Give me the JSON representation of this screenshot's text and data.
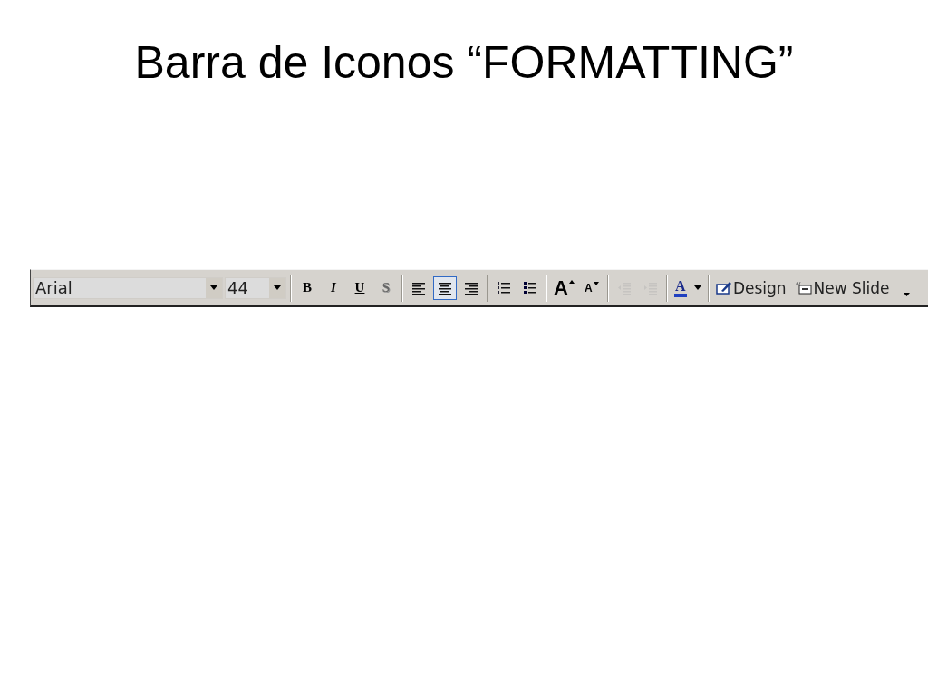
{
  "slide": {
    "title": "Barra de Iconos “FORMATTING”"
  },
  "toolbar": {
    "font": {
      "value": "Arial"
    },
    "size": {
      "value": "44"
    },
    "groups": [
      [
        {
          "kind": "bold",
          "label": "B",
          "disabled": false
        },
        {
          "kind": "italic",
          "label": "I",
          "disabled": false
        },
        {
          "kind": "underline",
          "label": "U",
          "disabled": false
        },
        {
          "kind": "shadow",
          "label": "S",
          "disabled": false
        }
      ],
      [
        {
          "kind": "align-left",
          "selected": false,
          "disabled": false
        },
        {
          "kind": "align-center",
          "selected": true,
          "disabled": false
        },
        {
          "kind": "align-right",
          "selected": false,
          "disabled": false
        }
      ],
      [
        {
          "kind": "numbering",
          "disabled": false
        },
        {
          "kind": "bullets",
          "disabled": false
        }
      ],
      [
        {
          "kind": "grow-font",
          "label": "A",
          "disabled": false
        },
        {
          "kind": "shrink-font",
          "label": "A",
          "disabled": false
        }
      ],
      [
        {
          "kind": "outdent",
          "disabled": true
        },
        {
          "kind": "indent",
          "disabled": true
        }
      ],
      [
        {
          "kind": "font-color",
          "label": "A",
          "disabled": false
        }
      ],
      [
        {
          "kind": "design",
          "label": "Design",
          "disabled": false
        },
        {
          "kind": "new-slide",
          "label": "New Slide",
          "disabled": false
        },
        {
          "kind": "overflow",
          "disabled": false
        }
      ]
    ]
  }
}
